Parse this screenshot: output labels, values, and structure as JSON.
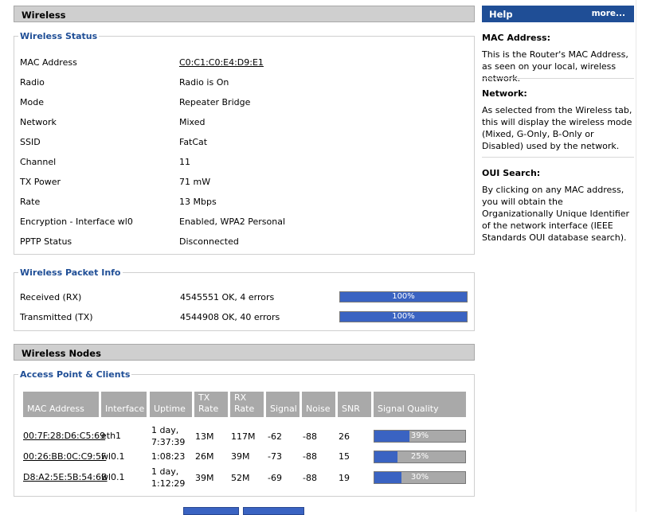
{
  "wireless_header": "Wireless",
  "status": {
    "legend": "Wireless Status",
    "rows": [
      {
        "label": "MAC Address",
        "value": "C0:C1:C0:E4:D9:E1"
      },
      {
        "label": "Radio",
        "value": "Radio is On"
      },
      {
        "label": "Mode",
        "value": "Repeater Bridge"
      },
      {
        "label": "Network",
        "value": "Mixed"
      },
      {
        "label": "SSID",
        "value": "FatCat"
      },
      {
        "label": "Channel",
        "value": "11"
      },
      {
        "label": "TX Power",
        "value": "71 mW"
      },
      {
        "label": "Rate",
        "value": "13 Mbps"
      },
      {
        "label": "Encryption - Interface wl0",
        "value": "Enabled, WPA2 Personal"
      },
      {
        "label": "PPTP Status",
        "value": "Disconnected"
      }
    ]
  },
  "packet": {
    "legend": "Wireless Packet Info",
    "rows": [
      {
        "label": "Received (RX)",
        "value": "4545551 OK, 4 errors",
        "bar": "100%",
        "level": 1.0
      },
      {
        "label": "Transmitted (TX)",
        "value": "4544908 OK, 40 errors",
        "bar": "100%",
        "level": 1.0
      }
    ]
  },
  "nodes_header": "Wireless Nodes",
  "clients": {
    "legend": "Access Point & Clients",
    "columns": [
      "MAC Address",
      "Interface",
      "Uptime",
      "TX Rate",
      "RX Rate",
      "Signal",
      "Noise",
      "SNR",
      "Signal Quality"
    ],
    "rows": [
      {
        "mac": "00:7F:28:D6:C5:69",
        "iface": "eth1",
        "uptime1": "1 day,",
        "uptime2": "7:37:39",
        "tx": "13M",
        "rx": "117M",
        "signal": "-62",
        "noise": "-88",
        "snr": "26",
        "quality": "39%",
        "level": 0.39
      },
      {
        "mac": "00:26:BB:0C:C9:5F",
        "iface": "wl0.1",
        "uptime1": "1:08:23",
        "uptime2": "",
        "tx": "26M",
        "rx": "39M",
        "signal": "-73",
        "noise": "-88",
        "snr": "15",
        "quality": "25%",
        "level": 0.25
      },
      {
        "mac": "D8:A2:5E:5B:54:6B",
        "iface": "wl0.1",
        "uptime1": "1 day,",
        "uptime2": "1:12:29",
        "tx": "39M",
        "rx": "52M",
        "signal": "-69",
        "noise": "-88",
        "snr": "19",
        "quality": "30%",
        "level": 0.3
      }
    ]
  },
  "help": {
    "title": "Help",
    "more": "more...",
    "sections": [
      {
        "title": "MAC Address:",
        "text": "This is the Router's MAC Address, as seen on your local, wireless network."
      },
      {
        "title": "Network:",
        "text": "As selected from the Wireless tab, this will display the wireless mode (Mixed, G-Only, B-Only or Disabled) used by the network."
      },
      {
        "title": "OUI Search:",
        "text": "By clicking on any MAC address, you will obtain the Organizationally Unique Identifier of the network interface (IEEE Standards OUI database search)."
      }
    ]
  },
  "colors": {
    "accent": "#1f4e96",
    "bar_fill": "#3a63c2",
    "bar_bg": "#a9a9a9",
    "header_bg": "#cfcfcf"
  }
}
